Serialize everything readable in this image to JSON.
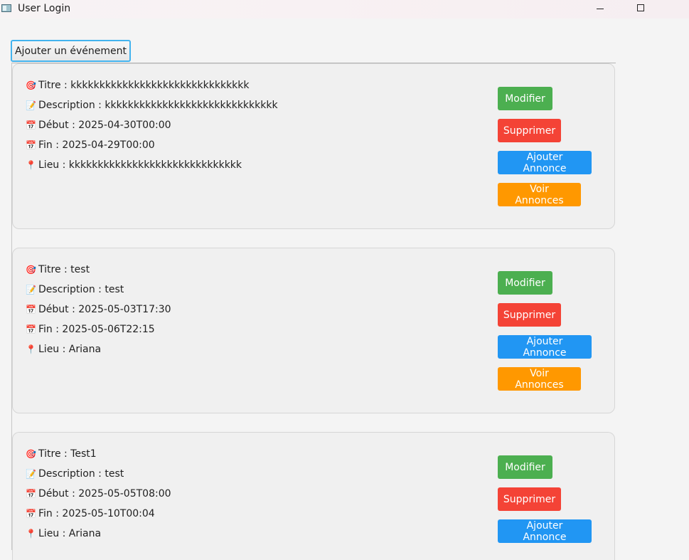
{
  "window": {
    "title": "User Login",
    "controls": [
      "minimize",
      "maximize"
    ]
  },
  "toolbar": {
    "add_event_label": "Ajouter un événement"
  },
  "row_icons": {
    "title": "🎯",
    "description": "📝",
    "start": "📅",
    "end": "📅",
    "location": "📍"
  },
  "events": [
    {
      "title": "Titre : kkkkkkkkkkkkkkkkkkkkkkkkkkkkkkk",
      "description": "Description : kkkkkkkkkkkkkkkkkkkkkkkkkkkkkk",
      "start": "Début : 2025-04-30T00:00",
      "end": "Fin : 2025-04-29T00:00",
      "location": "Lieu : kkkkkkkkkkkkkkkkkkkkkkkkkkkkkk",
      "buttons": {
        "edit": "Modifier",
        "delete": "Supprimer",
        "add_announce": "Ajouter Annonce",
        "view_announce": "Voir Annonces"
      }
    },
    {
      "title": "Titre : test",
      "description": "Description : test",
      "start": "Début : 2025-05-03T17:30",
      "end": "Fin : 2025-05-06T22:15",
      "location": "Lieu : Ariana",
      "buttons": {
        "edit": "Modifier",
        "delete": "Supprimer",
        "add_announce": "Ajouter Annonce",
        "view_announce": "Voir Annonces"
      }
    },
    {
      "title": "Titre : Test1",
      "description": "Description : test",
      "start": "Début : 2025-05-05T08:00",
      "end": "Fin : 2025-05-10T00:04",
      "location": "Lieu : Ariana",
      "buttons": {
        "edit": "Modifier",
        "delete": "Supprimer",
        "add_announce": "Ajouter Annonce"
      }
    }
  ],
  "colors": {
    "edit": "#4caf50",
    "delete": "#f44336",
    "add_announce": "#2196f3",
    "view_announce": "#ff9800",
    "focus_border": "#43b3ee"
  }
}
